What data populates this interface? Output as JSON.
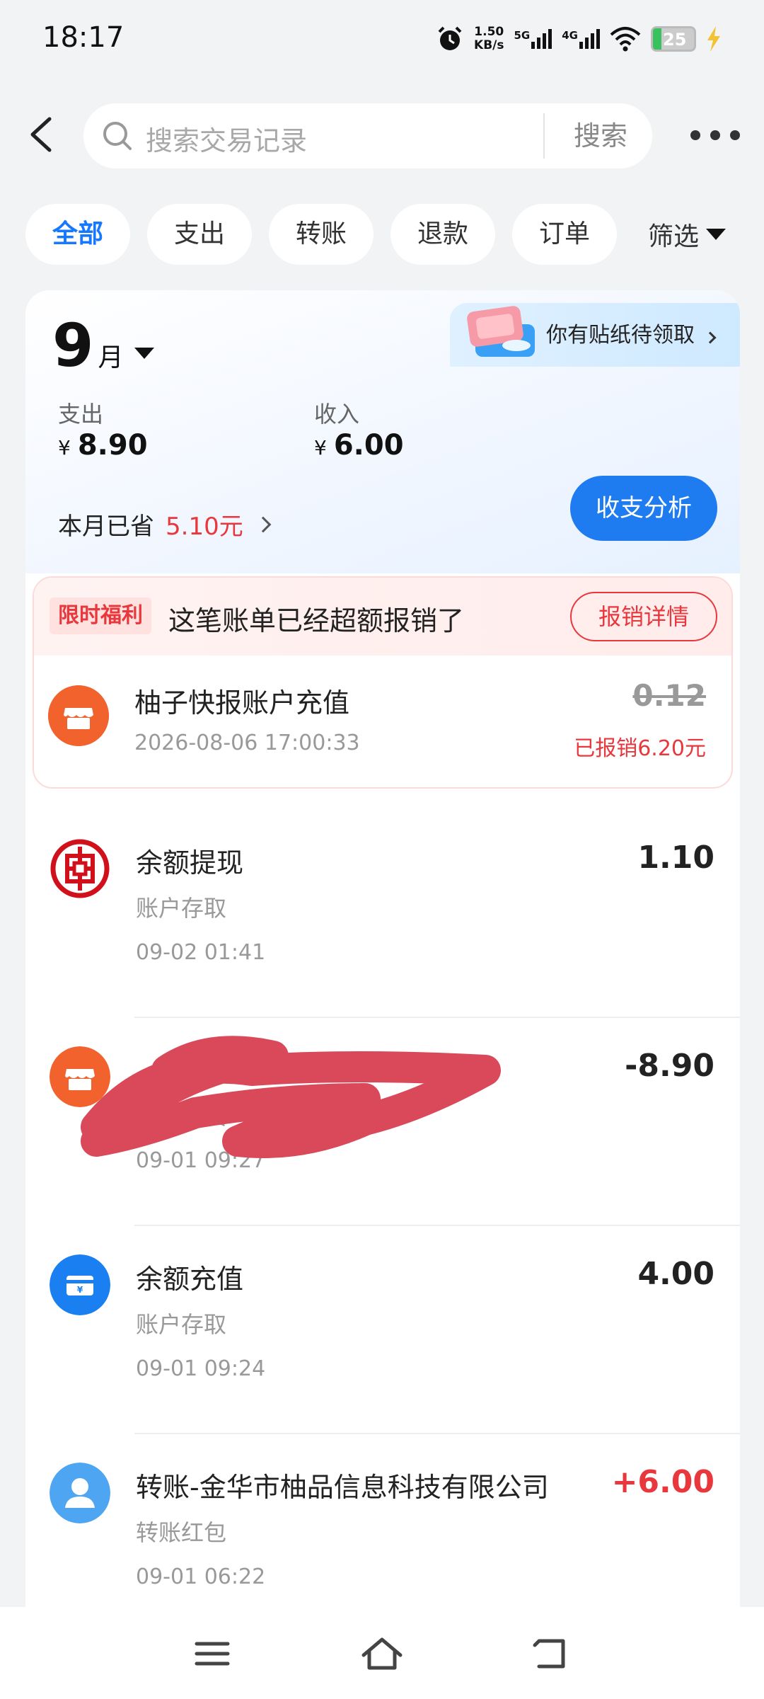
{
  "status_bar": {
    "time": "18:17",
    "net_speed_value": "1.50",
    "net_speed_unit": "KB/s",
    "signal_1_label": "5G",
    "signal_2_label": "4G",
    "battery_level": "25",
    "icons": [
      "alarm-icon",
      "signal-5g-icon",
      "signal-4g-icon",
      "wifi-icon",
      "battery-icon",
      "charging-icon"
    ]
  },
  "header": {
    "search_placeholder": "搜索交易记录",
    "search_button": "搜索"
  },
  "tabs": [
    {
      "label": "全部",
      "active": true
    },
    {
      "label": "支出",
      "active": false
    },
    {
      "label": "转账",
      "active": false
    },
    {
      "label": "退款",
      "active": false
    },
    {
      "label": "订单",
      "active": false
    }
  ],
  "filter_label": "筛选",
  "summary": {
    "sticker_text": "你有贴纸待领取",
    "month_number": "9",
    "month_unit": "月",
    "expense_label": "支出",
    "expense_currency": "¥",
    "expense_value": "8.90",
    "income_label": "收入",
    "income_currency": "¥",
    "income_value": "6.00",
    "saved_label": "本月已省",
    "saved_value": "5.10元",
    "analysis_button": "收支分析"
  },
  "reimbursement": {
    "badge": "限时福利",
    "message": "这笔账单已经超额报销了",
    "details_button": "报销详情",
    "merchant": "柚子快报账户充值",
    "datetime": "2026-08-06 17:00:33",
    "amount": "0.12",
    "reimbursed_text": "已报销6.20元"
  },
  "transactions": [
    {
      "title": "余额提现",
      "category": "账户存取",
      "time": "09-02 01:41",
      "amount": "1.10",
      "icon": "bank-icon",
      "redacted": false
    },
    {
      "title": "",
      "category": "日用百货",
      "time": "09-01 09:27",
      "amount": "-8.90",
      "icon": "store-icon",
      "redacted": true
    },
    {
      "title": "余额充值",
      "category": "账户存取",
      "time": "09-01 09:24",
      "amount": "4.00",
      "icon": "wallet-card-icon",
      "redacted": false
    },
    {
      "title": "转账-金华市柚品信息科技有限公司",
      "category": "转账红包",
      "time": "09-01 06:22",
      "amount": "+6.00",
      "icon": "user-avatar-icon",
      "redacted": false
    }
  ],
  "colors": {
    "accent_blue": "#1677ff",
    "income_red": "#e8383d",
    "store_orange": "#f2622d",
    "bank_red": "#d0111b",
    "redaction_red": "#d9495a"
  }
}
